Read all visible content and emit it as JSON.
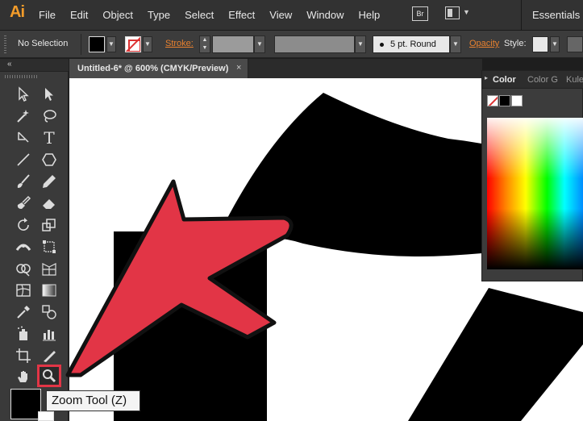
{
  "app": {
    "logo_text": "Ai",
    "brand_color": "#f39c2a"
  },
  "menubar": {
    "items": [
      "File",
      "Edit",
      "Object",
      "Type",
      "Select",
      "Effect",
      "View",
      "Window",
      "Help"
    ],
    "bridge_label": "Br",
    "workspace_label": "Essentials"
  },
  "controlbar": {
    "selection_status": "No Selection",
    "stroke_label": "Stroke:",
    "brush_profile": "5 pt. Round",
    "opacity_label": "Opacity",
    "style_label": "Style:",
    "accent_color": "#e8812f"
  },
  "document": {
    "tab_title": "Untitled-6* @ 600% (CMYK/Preview)",
    "close_glyph": "×"
  },
  "tools": [
    {
      "name": "selection-tool-icon"
    },
    {
      "name": "direct-selection-tool-icon"
    },
    {
      "name": "magic-wand-tool-icon"
    },
    {
      "name": "lasso-tool-icon"
    },
    {
      "name": "pen-tool-icon"
    },
    {
      "name": "type-tool-icon"
    },
    {
      "name": "line-segment-tool-icon"
    },
    {
      "name": "polygon-tool-icon"
    },
    {
      "name": "paintbrush-tool-icon"
    },
    {
      "name": "pencil-tool-icon"
    },
    {
      "name": "blob-brush-tool-icon"
    },
    {
      "name": "eraser-tool-icon"
    },
    {
      "name": "rotate-tool-icon"
    },
    {
      "name": "scale-tool-icon"
    },
    {
      "name": "width-tool-icon"
    },
    {
      "name": "free-transform-tool-icon"
    },
    {
      "name": "shape-builder-tool-icon"
    },
    {
      "name": "perspective-grid-tool-icon"
    },
    {
      "name": "mesh-tool-icon"
    },
    {
      "name": "gradient-tool-icon"
    },
    {
      "name": "eyedropper-tool-icon"
    },
    {
      "name": "blend-tool-icon"
    },
    {
      "name": "symbol-sprayer-tool-icon"
    },
    {
      "name": "column-graph-tool-icon"
    },
    {
      "name": "artboard-tool-icon"
    },
    {
      "name": "slice-tool-icon"
    },
    {
      "name": "hand-tool-icon"
    },
    {
      "name": "zoom-tool-icon"
    }
  ],
  "colorpanel": {
    "tabs": [
      {
        "label": "Color",
        "active": true
      },
      {
        "label": "Color G",
        "active": false
      },
      {
        "label": "Kule",
        "active": false
      }
    ],
    "collapse_glyph": "▸"
  },
  "tooltip": {
    "text": "Zoom Tool (Z)"
  },
  "highlight_color": "#e23546"
}
